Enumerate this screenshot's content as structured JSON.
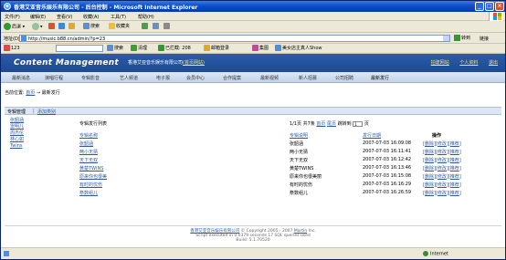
{
  "window": {
    "title": "香港艾亚音乐娱乐有限公司 - 后台控制 - Microsoft Internet Explorer",
    "icon": "ie-icon",
    "controls": [
      "_",
      "□",
      "×"
    ]
  },
  "menu": [
    "文件(F)",
    "编辑(E)",
    "查看(V)",
    "收藏(A)",
    "工具(T)",
    "帮助(H)"
  ],
  "toolbar": {
    "back": "后退",
    "search": "搜索",
    "favorites": "收藏夹"
  },
  "address": {
    "label": "地址(D)",
    "url": "http://music.b88.cn/admin/?p=23",
    "go": "转到",
    "links": "链接"
  },
  "toolbar2": {
    "zoom": "123",
    "search": "搜索",
    "clean": "清理",
    "blocked": "已拦截: 208",
    "mail": "邮箱登录",
    "album": "集图",
    "news": "美女店主真人Show"
  },
  "page": {
    "brand": "Content Management",
    "company": "香港艾亚音乐娱乐有限公司",
    "company_link": "(首页网站)",
    "top_links": [
      "拍建网站",
      "个人资料",
      "退出"
    ]
  },
  "nav": [
    "最新消息",
    "演唱行程",
    "专辑影音",
    "艺人频道",
    "电子报",
    "会员中心",
    "合作提案",
    "最新视频",
    "新人招募",
    "公司招聘",
    "最新发行"
  ],
  "breadcrumb": {
    "label": "当前位置:",
    "home": "首页",
    "arrow": "→",
    "current": "最新发行"
  },
  "subnav": {
    "title": "专辑管理",
    "add": "添加类别"
  },
  "sidebar": [
    "张韶涵",
    "雷明儿",
    "周杰伦",
    "林心如",
    "Twins"
  ],
  "list": {
    "title": "专辑发行列表",
    "pager": {
      "info": "1/1页 共7条",
      "first": "首页",
      "last": "尾页",
      "jump": "跳转到",
      "page": "1",
      "unit": "页"
    },
    "headers": {
      "name": "专辑名称",
      "author": "专辑说明",
      "date": "发行日期",
      "ops": "操作"
    },
    "rows": [
      {
        "name": "张韶涵",
        "author": "张韶涵",
        "date": "2007-07-03 16:09:08",
        "ops": [
          "删除",
          "修改",
          "推荐"
        ]
      },
      {
        "name": "两小无猜",
        "author": "两小无猜",
        "date": "2007-07-03 16:11:41",
        "ops": [
          "删除",
          "修改",
          "推荐"
        ]
      },
      {
        "name": "天下无双",
        "author": "天下无双",
        "date": "2007-07-03 16:12:42",
        "ops": [
          "删除",
          "修改",
          "推荐"
        ]
      },
      {
        "name": "黄楚TWINS",
        "author": "黄楚TWINS",
        "date": "2007-07-03 16:13:46",
        "ops": [
          "删除",
          "修改",
          "推荐"
        ]
      },
      {
        "name": "原来你也很美",
        "author": "原来你也很美丽",
        "date": "2007-07-03 16:15:08",
        "ops": [
          "删除",
          "修改",
          "推荐"
        ]
      },
      {
        "name": "有时的忧伤",
        "author": "有时的忧伤",
        "date": "2007-07-03 16:16:29",
        "ops": [
          "删除",
          "修改",
          "推荐"
        ]
      },
      {
        "name": "祭数组儿",
        "author": "祭数组儿",
        "date": "2007-07-03 16:26:59",
        "ops": [
          "删除",
          "修改",
          "推荐"
        ]
      }
    ]
  },
  "footer": {
    "company": "香港艾亚音乐娱乐有限公司",
    "copyright": "© Copyright 2005 - 2007",
    "vendor": "Martin",
    "suffix": "Inc.",
    "line2": "Script executed in 0.0379 seconds 17 SQL queries used",
    "line3": "Build: 5.1.70520"
  },
  "status": {
    "zone": "Internet"
  },
  "colors": {
    "titlebar": "#0a4fcf",
    "banner": "#1d4a95",
    "link": "#2f5ba8",
    "nav_bg": "#c4d3ea"
  }
}
